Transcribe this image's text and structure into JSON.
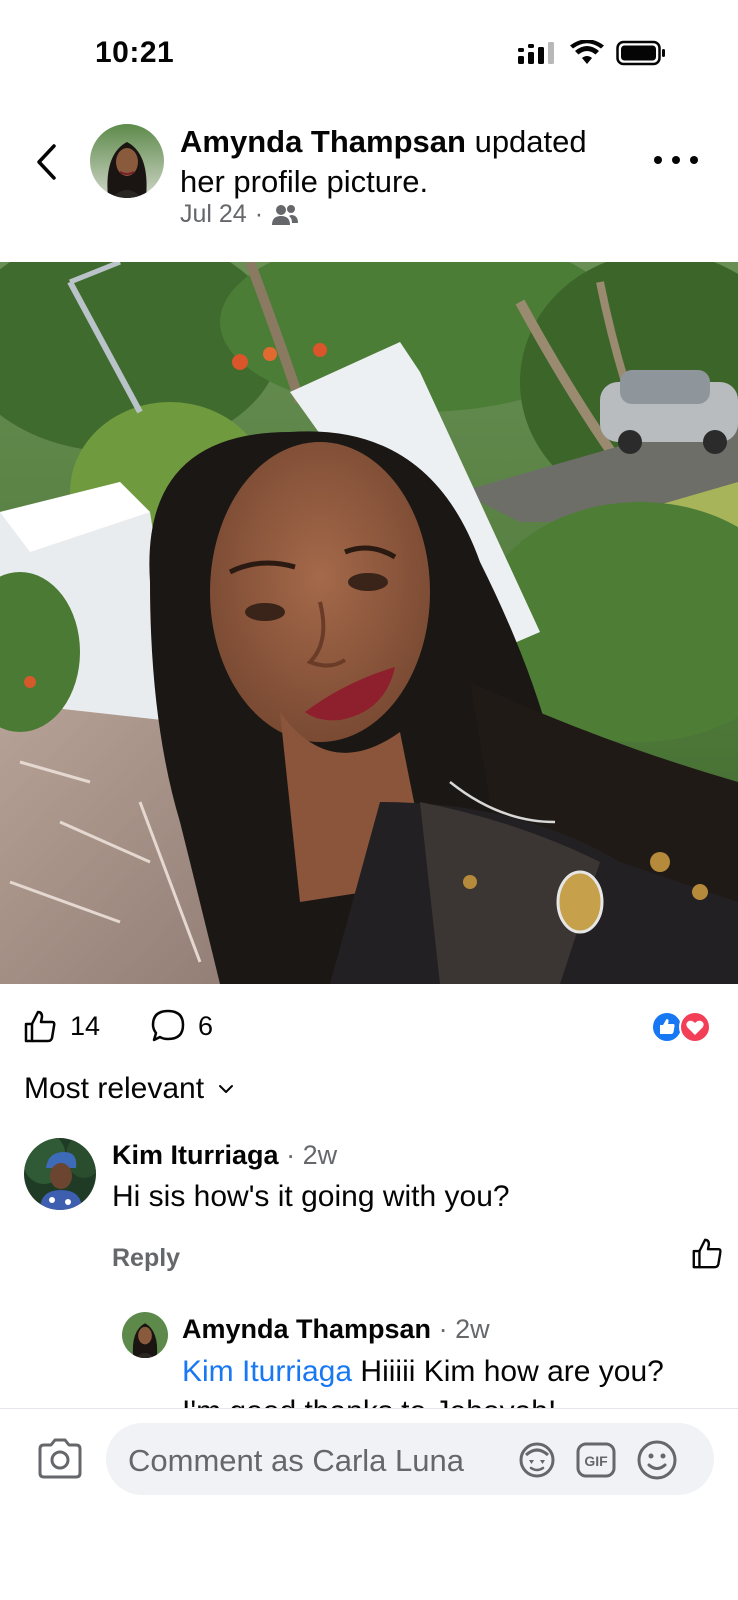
{
  "status_bar": {
    "time": "10:21",
    "icons": [
      "cellular-signal-icon",
      "wifi-icon",
      "battery-icon"
    ]
  },
  "post": {
    "author": "Amynda Thampsan",
    "action": "updated her profile picture.",
    "date": "Jul 24",
    "audience_icon": "friends-icon",
    "photo_description_icon": "profile-photo"
  },
  "reactions": {
    "likes": "14",
    "comments": "6",
    "reaction_types": [
      "like",
      "love"
    ]
  },
  "sort": {
    "label": "Most relevant"
  },
  "comments": [
    {
      "name": "Kim Iturriaga",
      "time": "2w",
      "text": "Hi sis how's it going with you?",
      "reply_label": "Reply"
    },
    {
      "name": "Amynda Thampsan",
      "time": "2w",
      "mention": "Kim Iturriaga",
      "text": "Hiiiii Kim how are you? I'm good thanks to Jehovah!"
    }
  ],
  "composer": {
    "placeholder": "Comment as Carla Luna",
    "gif_label": "GIF"
  },
  "colors": {
    "accent": "#1877f2",
    "love": "#f33e58",
    "muted": "#65676b"
  }
}
